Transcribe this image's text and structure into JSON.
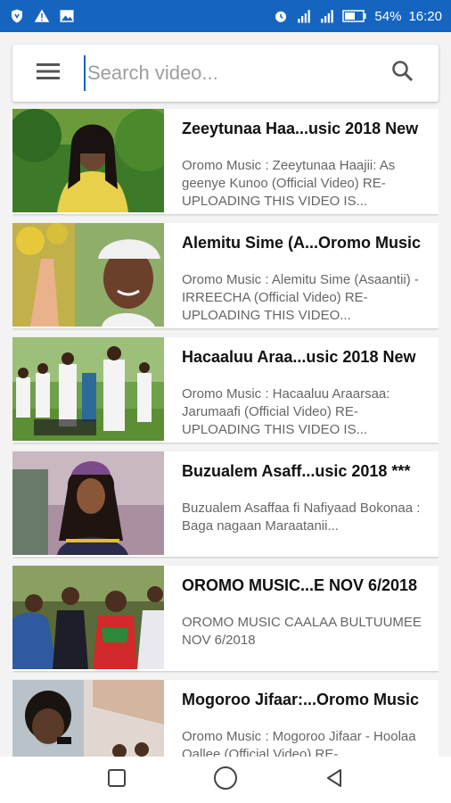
{
  "status_bar": {
    "battery": "54%",
    "time": "16:20",
    "icons": [
      "shield-icon",
      "warning-icon",
      "image-icon",
      "alarm-icon",
      "signal-icon",
      "signal-2g-icon",
      "battery-icon"
    ]
  },
  "search": {
    "placeholder": "Search video...",
    "value": ""
  },
  "colors": {
    "status_bar": "#1565c0",
    "accent": "#1565c0"
  },
  "videos": [
    {
      "title": "Zeeytunaa Haa...usic 2018 New",
      "description": "Oromo Music : Zeeytunaa Haajii: As geenye Kunoo (Official Video) RE-UPLOADING THIS VIDEO IS..."
    },
    {
      "title": "Alemitu Sime (A...Oromo Music",
      "description": "Oromo Music : Alemitu Sime (Asaantii) - IRREECHA (Official Video) RE-UPLOADING THIS VIDEO..."
    },
    {
      "title": "Hacaaluu Araa...usic 2018 New",
      "description": "Oromo Music : Hacaaluu Araarsaa: Jarumaafi (Official Video) RE-UPLOADING THIS VIDEO IS..."
    },
    {
      "title": "Buzualem Asaff...usic 2018 ***",
      "description": "Buzualem Asaffaa fi Nafiyaad Bokonaa : Baga nagaan Maraatanii..."
    },
    {
      "title": "OROMO MUSIC...E NOV 6/2018",
      "description": "OROMO MUSIC CAALAA BULTUUMEE NOV 6/2018"
    },
    {
      "title": "Mogoroo Jifaar:...Oromo Music",
      "description": "Oromo Music : Mogoroo Jifaar - Hoolaa Qallee (Official Video) RE-"
    }
  ]
}
